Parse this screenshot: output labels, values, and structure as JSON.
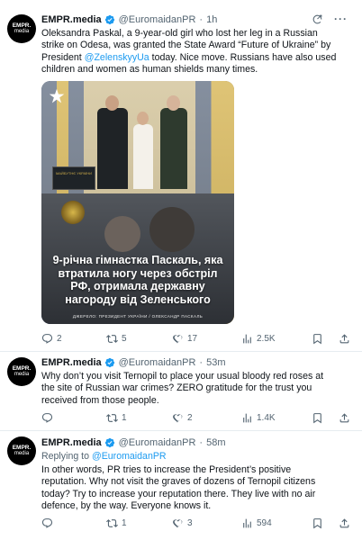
{
  "avatar": {
    "line1": "EMPR.",
    "line2": "media"
  },
  "tweets": [
    {
      "name": "EMPR.media",
      "handle": "@EuromaidanPR",
      "sep": "·",
      "time": "1h",
      "text_before": "Oleksandra Paskal, a 9-year-old girl who lost her leg in a Russian strike on Odesa, was granted the State Award “Future of Ukraine” by President ",
      "mention": "@ZelenskyyUa",
      "text_after": " today. Nice move. Russians have also used children and women as human shields many times.",
      "media": {
        "caption": "9-річна гімнастка Паскаль, яка втратила ногу через обстріл РФ, отримала державну нагороду від Зеленського",
        "credit": "ДЖЕРЕЛО: ПРЕЗИДЕНТ УКРАЇНИ / ОЛЕКСАНДР ПАСКАЛЬ",
        "award_text": "МАЙБУТНЄ УКРАЇНИ"
      },
      "replies": "2",
      "retweets": "5",
      "likes": "17",
      "views": "2.5K"
    },
    {
      "name": "EMPR.media",
      "handle": "@EuromaidanPR",
      "sep": "·",
      "time": "53m",
      "text": "Why don’t you visit Ternopil to place your usual bloody red roses at the site of Russian war crimes? ZERO gratitude for the trust you received from those people.",
      "replies": "",
      "retweets": "1",
      "likes": "2",
      "views": "1.4K"
    },
    {
      "name": "EMPR.media",
      "handle": "@EuromaidanPR",
      "sep": "·",
      "time": "58m",
      "reply_prefix": "Replying to ",
      "reply_handle": "@EuromaidanPR",
      "text": "In other words, PR tries to increase the President’s positive reputation. Why not visit the graves of dozens of Ternopil citizens today? Try to increase your reputation there. They live with no air defence, by the way. Everyone knows it.",
      "replies": "",
      "retweets": "1",
      "likes": "3",
      "views": "594"
    }
  ],
  "icons": {
    "grok": "grok-icon",
    "more": "more-icon",
    "reply": "reply-icon",
    "retweet": "retweet-icon",
    "like": "like-icon",
    "views": "views-icon",
    "bookmark": "bookmark-icon",
    "share": "share-icon"
  },
  "colors": {
    "link": "#1d9bf0",
    "secondary": "#536471",
    "verified": "#1d9bf0",
    "divider": "#e6ecf0"
  },
  "more_dots": "···"
}
